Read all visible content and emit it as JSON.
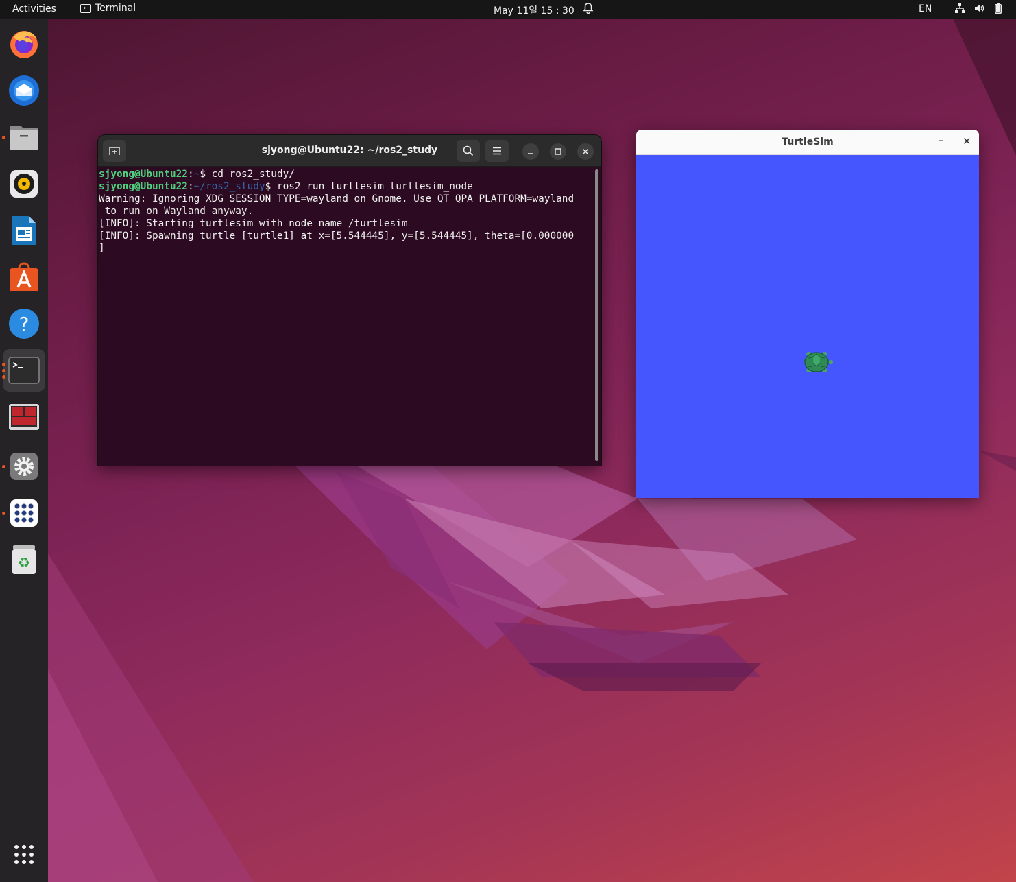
{
  "topbar": {
    "activities": "Activities",
    "app_name": "Terminal",
    "clock": "May 11일  15 : 30",
    "language": "EN"
  },
  "dock": {
    "items": [
      {
        "name": "firefox-icon"
      },
      {
        "name": "thunderbird-icon"
      },
      {
        "name": "files-icon"
      },
      {
        "name": "rhythmbox-icon"
      },
      {
        "name": "libreoffice-writer-icon"
      },
      {
        "name": "ubuntu-software-icon"
      },
      {
        "name": "help-icon"
      },
      {
        "name": "terminal-icon"
      },
      {
        "name": "terminator-icon"
      },
      {
        "name": "settings-icon"
      },
      {
        "name": "app-grid-icon"
      },
      {
        "name": "trash-icon"
      }
    ],
    "show_apps": "show-applications-icon"
  },
  "terminal": {
    "title": "sjyong@Ubuntu22: ~/ros2_study",
    "line1_user": "sjyong@Ubuntu22",
    "line1_sep": ":",
    "line1_path": "~",
    "line1_cmd": "$ cd ros2_study/",
    "line2_user": "sjyong@Ubuntu22",
    "line2_sep": ":",
    "line2_path": "~/ros2_study",
    "line2_cmd": "$ ros2 run turtlesim turtlesim_node",
    "line3": "Warning: Ignoring XDG_SESSION_TYPE=wayland on Gnome. Use QT_QPA_PLATFORM=wayland",
    "line4": " to run on Wayland anyway.",
    "line5": "[INFO]: Starting turtlesim with node name /turtlesim",
    "line6": "[INFO]: Spawning turtle [turtle1] at x=[5.544445], y=[5.544445], theta=[0.000000",
    "line7": "]"
  },
  "turtlesim": {
    "title": "TurtleSim",
    "minimize": "–",
    "close": "✕",
    "background_color": "#4556ff"
  }
}
